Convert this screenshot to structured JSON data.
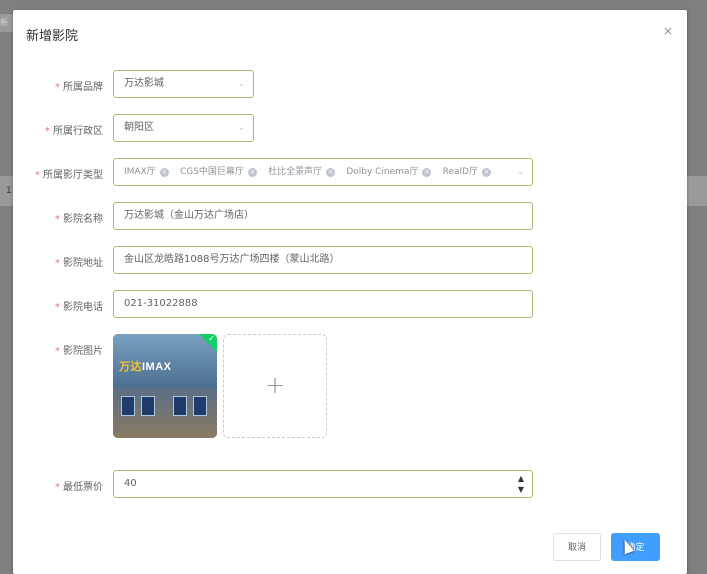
{
  "background": {
    "tab_text": "新增",
    "row_number": "1"
  },
  "dialog": {
    "title": "新增影院",
    "close_icon": "×",
    "cancel_label": "取消",
    "confirm_label": "确定"
  },
  "form": {
    "brand": {
      "label": "所属品牌",
      "value": "万达影城"
    },
    "district": {
      "label": "所属行政区",
      "value": "朝阳区"
    },
    "hall_types": {
      "label": "所属影厅类型",
      "tags": [
        "IMAX厅",
        "CGS中国巨幕厅",
        "杜比全景声厅",
        "Dolby Cinema厅",
        "RealD厅"
      ]
    },
    "cinema_name": {
      "label": "影院名称",
      "value": "万达影城（金山万达广场店）"
    },
    "cinema_address": {
      "label": "影院地址",
      "value": "金山区龙皓路1088号万达广场四楼（蒙山北路）"
    },
    "cinema_phone": {
      "label": "影院电话",
      "value": "021-31022888"
    },
    "cinema_images": {
      "label": "影院图片",
      "brand_text_1": "万达",
      "brand_text_2": "IMAX"
    },
    "min_price": {
      "label": "最低票价",
      "value": "40"
    }
  },
  "icons": {
    "chevron": "chevron-down-icon",
    "close": "close-icon",
    "plus": "plus-icon",
    "check": "check-icon"
  }
}
